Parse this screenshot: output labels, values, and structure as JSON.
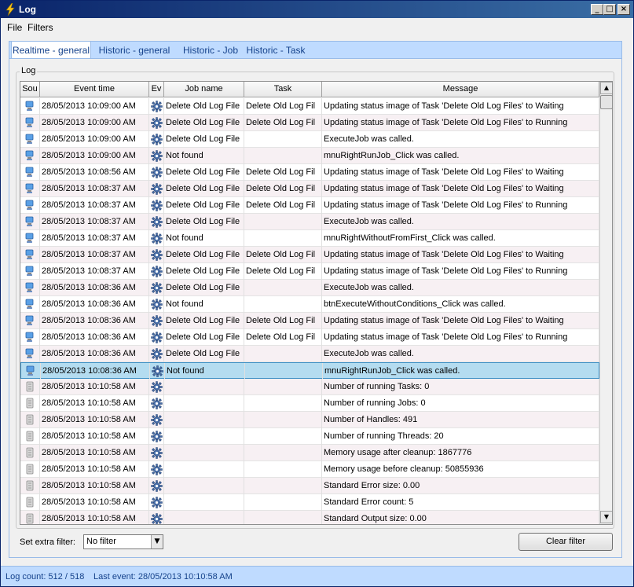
{
  "window": {
    "title": "Log",
    "buttons": {
      "minimize": "_",
      "maximize": "□",
      "close": "×"
    }
  },
  "menu": [
    {
      "label": "File"
    },
    {
      "label": "Filters"
    }
  ],
  "tabs": [
    {
      "label": "Realtime - general",
      "active": true
    },
    {
      "label": "Historic - general",
      "active": false
    },
    {
      "label": "Historic - Job",
      "active": false
    },
    {
      "label": "Historic - Task",
      "active": false
    }
  ],
  "log_group": {
    "title": "Log"
  },
  "grid": {
    "columns": [
      "Sou",
      "Event time",
      "Ev",
      "Job name",
      "Task",
      "Message"
    ],
    "rows": [
      {
        "source": "client",
        "time": "28/05/2013 10:09:00 AM",
        "job": "Delete Old Log File",
        "task": "Delete Old Log Fil",
        "message": "Updating status image of Task 'Delete Old Log Files' to Waiting"
      },
      {
        "source": "client",
        "time": "28/05/2013 10:09:00 AM",
        "job": "Delete Old Log File",
        "task": "Delete Old Log Fil",
        "message": "Updating status image of Task 'Delete Old Log Files' to Running"
      },
      {
        "source": "client",
        "time": "28/05/2013 10:09:00 AM",
        "job": "Delete Old Log File",
        "task": "",
        "message": "ExecuteJob was called."
      },
      {
        "source": "client",
        "time": "28/05/2013 10:09:00 AM",
        "job": "Not found",
        "task": "",
        "message": "mnuRightRunJob_Click was called."
      },
      {
        "source": "client",
        "time": "28/05/2013 10:08:56 AM",
        "job": "Delete Old Log File",
        "task": "Delete Old Log Fil",
        "message": "Updating status image of Task 'Delete Old Log Files' to Waiting"
      },
      {
        "source": "client",
        "time": "28/05/2013 10:08:37 AM",
        "job": "Delete Old Log File",
        "task": "Delete Old Log Fil",
        "message": "Updating status image of Task 'Delete Old Log Files' to Waiting"
      },
      {
        "source": "client",
        "time": "28/05/2013 10:08:37 AM",
        "job": "Delete Old Log File",
        "task": "Delete Old Log Fil",
        "message": "Updating status image of Task 'Delete Old Log Files' to Running"
      },
      {
        "source": "client",
        "time": "28/05/2013 10:08:37 AM",
        "job": "Delete Old Log File",
        "task": "",
        "message": "ExecuteJob was called."
      },
      {
        "source": "client",
        "time": "28/05/2013 10:08:37 AM",
        "job": "Not found",
        "task": "",
        "message": "mnuRightWithoutFromFirst_Click was called."
      },
      {
        "source": "client",
        "time": "28/05/2013 10:08:37 AM",
        "job": "Delete Old Log File",
        "task": "Delete Old Log Fil",
        "message": "Updating status image of Task 'Delete Old Log Files' to Waiting"
      },
      {
        "source": "client",
        "time": "28/05/2013 10:08:37 AM",
        "job": "Delete Old Log File",
        "task": "Delete Old Log Fil",
        "message": "Updating status image of Task 'Delete Old Log Files' to Running"
      },
      {
        "source": "client",
        "time": "28/05/2013 10:08:36 AM",
        "job": "Delete Old Log File",
        "task": "",
        "message": "ExecuteJob was called."
      },
      {
        "source": "client",
        "time": "28/05/2013 10:08:36 AM",
        "job": "Not found",
        "task": "",
        "message": "btnExecuteWithoutConditions_Click was called."
      },
      {
        "source": "client",
        "time": "28/05/2013 10:08:36 AM",
        "job": "Delete Old Log File",
        "task": "Delete Old Log Fil",
        "message": "Updating status image of Task 'Delete Old Log Files' to Waiting"
      },
      {
        "source": "client",
        "time": "28/05/2013 10:08:36 AM",
        "job": "Delete Old Log File",
        "task": "Delete Old Log Fil",
        "message": "Updating status image of Task 'Delete Old Log Files' to Running"
      },
      {
        "source": "client",
        "time": "28/05/2013 10:08:36 AM",
        "job": "Delete Old Log File",
        "task": "",
        "message": "ExecuteJob was called."
      },
      {
        "source": "client",
        "time": "28/05/2013 10:08:36 AM",
        "job": "Not found",
        "task": "",
        "message": "mnuRightRunJob_Click was called.",
        "selected": true
      },
      {
        "source": "server",
        "time": "28/05/2013 10:10:58 AM",
        "job": "",
        "task": "",
        "message": "Number of running Tasks: 0"
      },
      {
        "source": "server",
        "time": "28/05/2013 10:10:58 AM",
        "job": "",
        "task": "",
        "message": "Number of running Jobs: 0"
      },
      {
        "source": "server",
        "time": "28/05/2013 10:10:58 AM",
        "job": "",
        "task": "",
        "message": "Number of Handles: 491"
      },
      {
        "source": "server",
        "time": "28/05/2013 10:10:58 AM",
        "job": "",
        "task": "",
        "message": "Number of running Threads: 20"
      },
      {
        "source": "server",
        "time": "28/05/2013 10:10:58 AM",
        "job": "",
        "task": "",
        "message": "Memory usage after cleanup: 1867776"
      },
      {
        "source": "server",
        "time": "28/05/2013 10:10:58 AM",
        "job": "",
        "task": "",
        "message": "Memory usage before cleanup: 50855936"
      },
      {
        "source": "server",
        "time": "28/05/2013 10:10:58 AM",
        "job": "",
        "task": "",
        "message": "Standard Error size: 0.00"
      },
      {
        "source": "server",
        "time": "28/05/2013 10:10:58 AM",
        "job": "",
        "task": "",
        "message": "Standard Error count: 5"
      },
      {
        "source": "server",
        "time": "28/05/2013 10:10:58 AM",
        "job": "",
        "task": "",
        "message": "Standard Output size: 0.00"
      }
    ]
  },
  "filter": {
    "label": "Set extra filter:",
    "value": "No filter",
    "clear_label": "Clear filter"
  },
  "status": {
    "log_count": "Log count: 512 / 518",
    "last_event": "Last event: 28/05/2013 10:10:58 AM"
  },
  "colors": {
    "title_bar": "#0a246a",
    "tab_strip": "#bfdbff",
    "selected_row": "#b4dcf0",
    "status_bar": "#bfdbff"
  }
}
